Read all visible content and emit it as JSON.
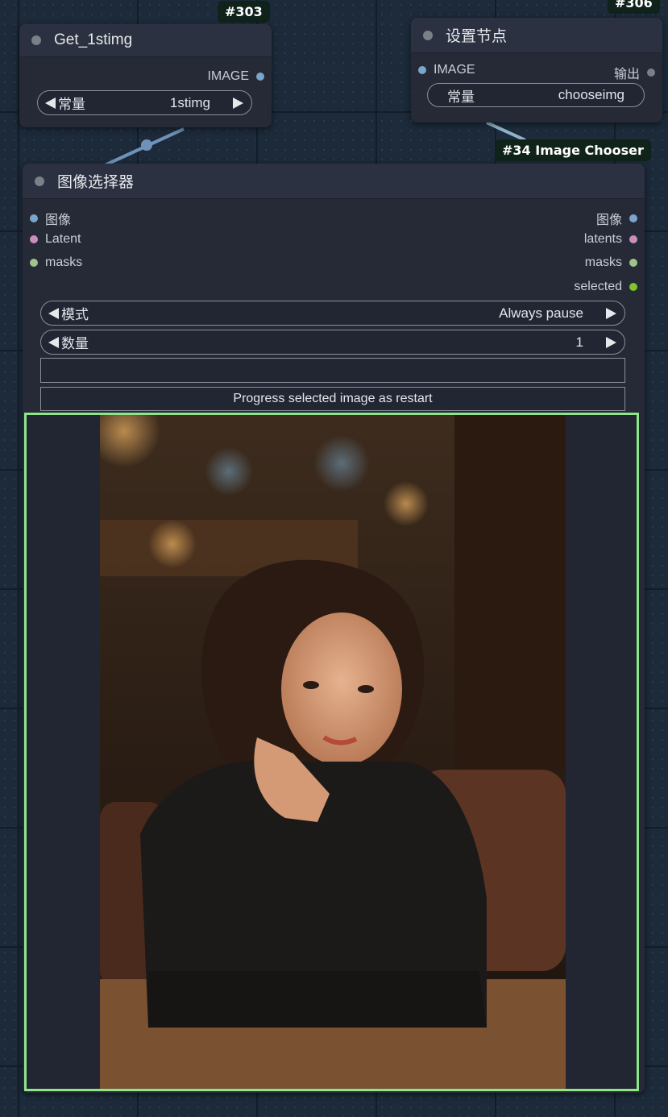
{
  "node_303": {
    "badge": "#303",
    "title": "Get_1stimg",
    "output_label": "IMAGE",
    "widget_label": "常量",
    "widget_value": "1stimg"
  },
  "node_306": {
    "badge": "#306",
    "title": "设置节点",
    "input_label": "IMAGE",
    "output_label": "输出",
    "widget_label": "常量",
    "widget_value": "chooseimg"
  },
  "node_34": {
    "badge": "#34 Image Chooser",
    "title": "图像选择器",
    "inputs": [
      "图像",
      "Latent",
      "masks"
    ],
    "outputs": [
      "图像",
      "latents",
      "masks",
      "selected"
    ],
    "mode_label": "模式",
    "mode_value": "Always pause",
    "count_label": "数量",
    "count_value": "1",
    "text_field_value": "",
    "progress_button": "Progress selected image as restart"
  },
  "colors": {
    "image_slot": "#7aa6cc",
    "latent_slot": "#c88fbd",
    "mask_slot": "#9ec48a",
    "selected_slot": "#7fc32f",
    "selection_border": "#8fe58a",
    "badge_bg": "#10231a"
  }
}
